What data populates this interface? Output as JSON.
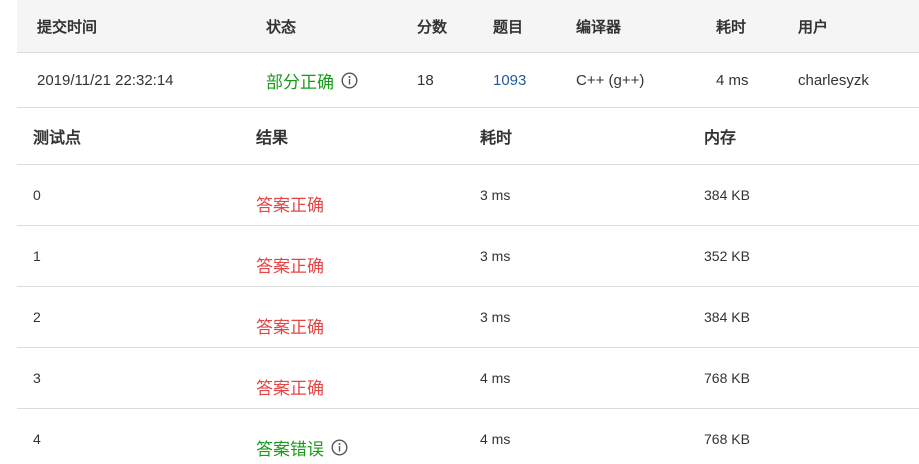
{
  "submission": {
    "headers": {
      "time": "提交时间",
      "status": "状态",
      "score": "分数",
      "problem": "题目",
      "compiler": "编译器",
      "cost": "耗时",
      "user": "用户"
    },
    "row": {
      "time": "2019/11/21 22:32:14",
      "status": "部分正确",
      "score": "18",
      "problem": "1093",
      "compiler": "C++ (g++)",
      "cost": "4 ms",
      "user": "charlesyzk"
    }
  },
  "tests": {
    "headers": {
      "id": "测试点",
      "result": "结果",
      "time": "耗时",
      "memory": "内存"
    },
    "rows": [
      {
        "id": "0",
        "result": "答案正确",
        "time": "3 ms",
        "memory": "384 KB"
      },
      {
        "id": "1",
        "result": "答案正确",
        "time": "3 ms",
        "memory": "352 KB"
      },
      {
        "id": "2",
        "result": "答案正确",
        "time": "3 ms",
        "memory": "384 KB"
      },
      {
        "id": "3",
        "result": "答案正确",
        "time": "4 ms",
        "memory": "768 KB"
      },
      {
        "id": "4",
        "result": "答案错误",
        "time": "4 ms",
        "memory": "768 KB"
      }
    ]
  },
  "colors": {
    "accepted": "#e64545",
    "partial": "#1a9a1a",
    "wrong": "#1a9a1a",
    "link": "#1f5a9a",
    "header_bg": "#f5f5f5"
  }
}
